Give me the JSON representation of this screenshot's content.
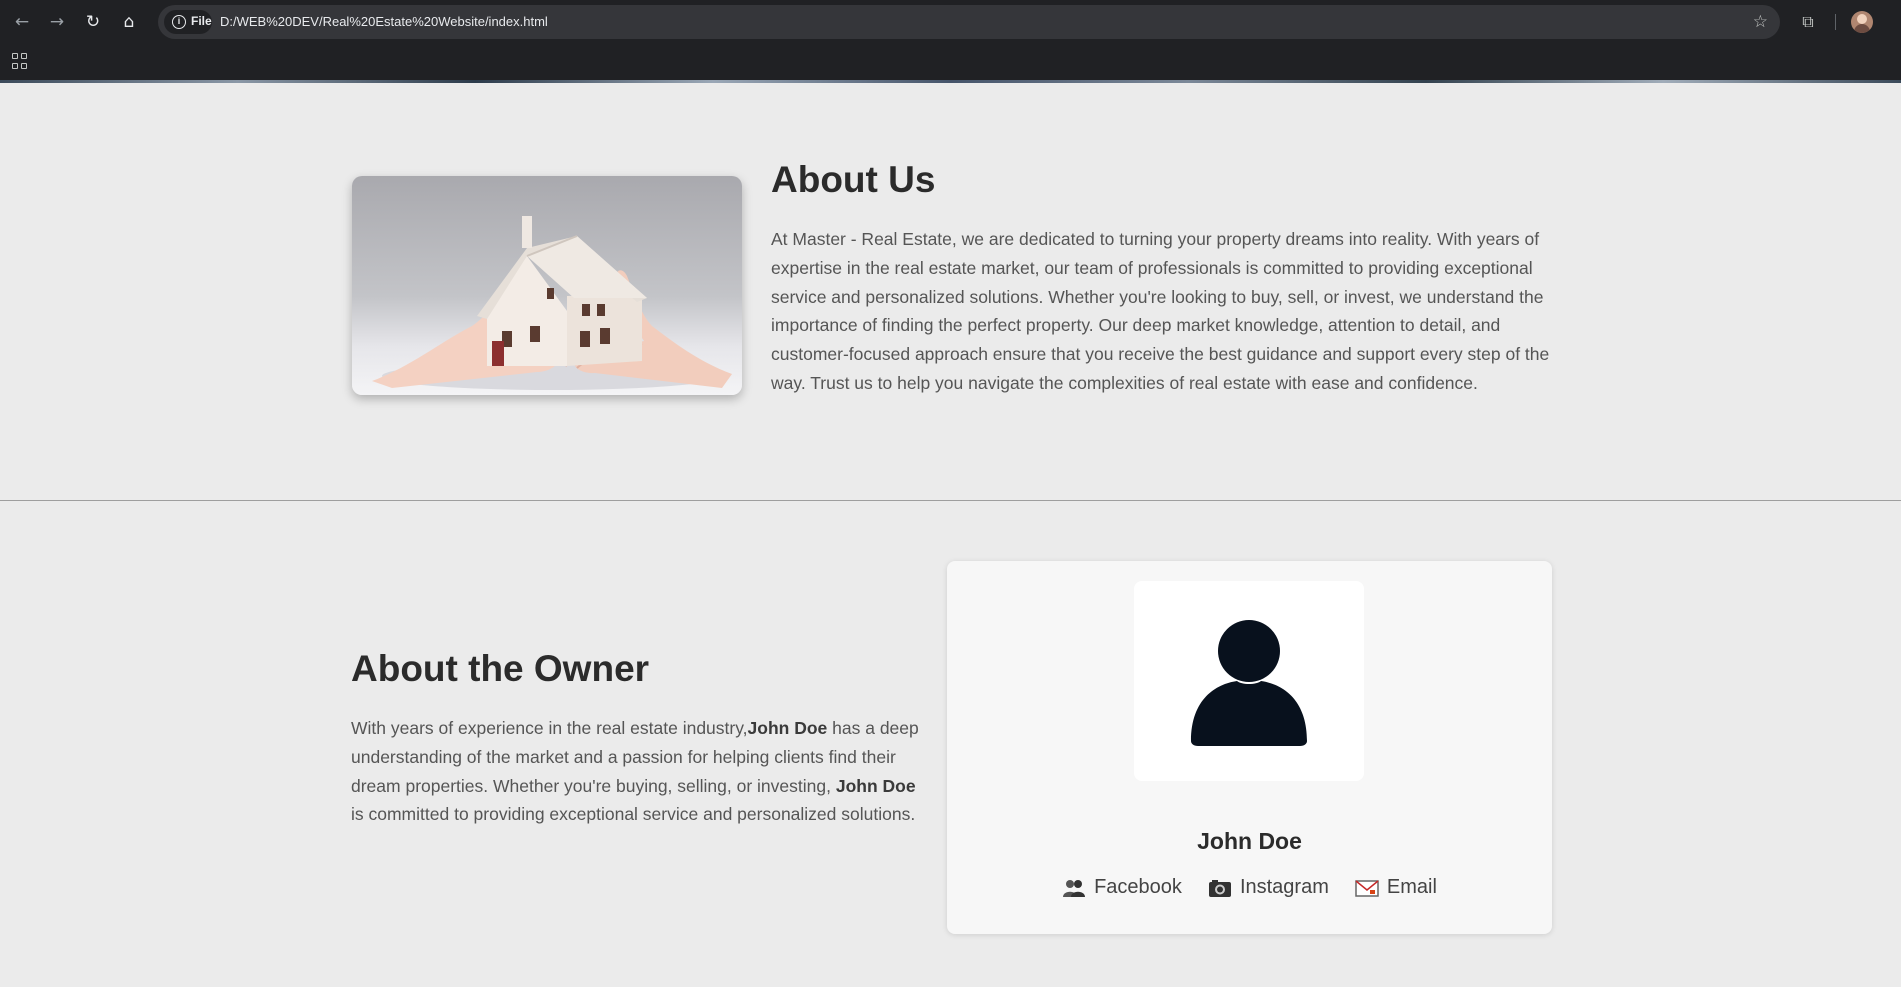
{
  "browser": {
    "file_chip": "File",
    "url": "D:/WEB%20DEV/Real%20Estate%20Website/index.html"
  },
  "about_us": {
    "title": "About Us",
    "text": "At Master - Real Estate, we are dedicated to turning your property dreams into reality. With years of expertise in the real estate market, our team of professionals is committed to providing exceptional service and personalized solutions. Whether you're looking to buy, sell, or invest, we understand the importance of finding the perfect property. Our deep market knowledge, attention to detail, and customer-focused approach ensure that you receive the best guidance and support every step of the way. Trust us to help you navigate the complexities of real estate with ease and confidence."
  },
  "owner": {
    "title": "About the Owner",
    "text_part1": "With years of experience in the real estate industry,",
    "name_bold_1": "John Doe",
    "text_part2": " has a deep understanding of the market and a passion for helping clients find their dream properties. Whether you're buying, selling, or investing, ",
    "name_bold_2": "John Doe",
    "text_part3": " is committed to providing exceptional service and personalized solutions.",
    "card_name": "John Doe",
    "social": [
      {
        "label": "Facebook",
        "icon": "people-icon"
      },
      {
        "label": "Instagram",
        "icon": "camera-icon"
      },
      {
        "label": "Email",
        "icon": "envelope-icon"
      }
    ]
  },
  "colors": {
    "page_bg": "#ebebeb",
    "card_bg": "#f7f7f7",
    "avatar_fill": "#08111d",
    "heading": "#2b2b2b",
    "body_text": "#555555"
  }
}
